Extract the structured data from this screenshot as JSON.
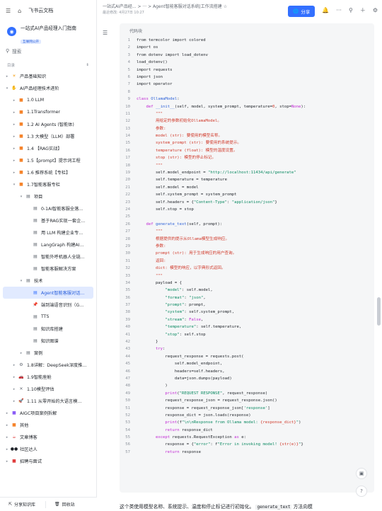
{
  "app": {
    "name": "飞书云文档"
  },
  "space": {
    "name": "一站式AI产品经理入门指南",
    "badge": "互联网公开"
  },
  "search": {
    "label": "搜索"
  },
  "toc": {
    "label": "目录"
  },
  "tree": [
    {
      "label": "产品基础知识",
      "depth": 0,
      "arrow": "▸",
      "icon": "☀",
      "color": "#f5a623",
      "active": false
    },
    {
      "label": "AI产品经理技术进阶",
      "depth": 0,
      "arrow": "▾",
      "icon": "✋",
      "color": "#f5a623",
      "active": false
    },
    {
      "label": "1.0 LLM",
      "depth": 1,
      "arrow": "▸",
      "icon": "■",
      "color": "#f5842c",
      "active": false
    },
    {
      "label": "1.1Transformer",
      "depth": 1,
      "arrow": "▸",
      "icon": "■",
      "color": "#f5842c",
      "active": false
    },
    {
      "label": "1.2 AI Agents (智能体)",
      "depth": 1,
      "arrow": "▸",
      "icon": "■",
      "color": "#f5842c",
      "active": false
    },
    {
      "label": "1.3 大模型（LLM）部署",
      "depth": 1,
      "arrow": "▸",
      "icon": "■",
      "color": "#f5842c",
      "active": false
    },
    {
      "label": "1.4 【RAG实战】",
      "depth": 1,
      "arrow": "▸",
      "icon": "■",
      "color": "#f5842c",
      "active": false
    },
    {
      "label": "1.5【prompt】提示词工程",
      "depth": 1,
      "arrow": "▸",
      "icon": "■",
      "color": "#f5842c",
      "active": false
    },
    {
      "label": "1.6 推荐系统【专栏】",
      "depth": 1,
      "arrow": "▸",
      "icon": "■",
      "color": "#f5842c",
      "active": false
    },
    {
      "label": "1.7智能客服专栏",
      "depth": 1,
      "arrow": "▾",
      "icon": "■",
      "color": "#f5842c",
      "active": false
    },
    {
      "label": "项目",
      "depth": 2,
      "arrow": "▾",
      "icon": "▤",
      "color": "#646a73",
      "active": false
    },
    {
      "label": "0-1AI智能客服全落...",
      "depth": 3,
      "arrow": "",
      "icon": "▤",
      "color": "#646a73",
      "active": false
    },
    {
      "label": "基于RAG实现一套企...",
      "depth": 3,
      "arrow": "",
      "icon": "▤",
      "color": "#646a73",
      "active": false
    },
    {
      "label": "用 LLM 构建企业专...",
      "depth": 3,
      "arrow": "",
      "icon": "▤",
      "color": "#646a73",
      "active": false
    },
    {
      "label": "LangGraph 构建AI...",
      "depth": 3,
      "arrow": "",
      "icon": "▤",
      "color": "#646a73",
      "active": false
    },
    {
      "label": "智能外呼机器人全链...",
      "depth": 3,
      "arrow": "",
      "icon": "▤",
      "color": "#646a73",
      "active": false
    },
    {
      "label": "智能客服解决方案",
      "depth": 3,
      "arrow": "",
      "icon": "▤",
      "color": "#646a73",
      "active": false
    },
    {
      "label": "技术",
      "depth": 2,
      "arrow": "▾",
      "icon": "▤",
      "color": "#646a73",
      "active": false
    },
    {
      "label": "Agent智能客服对话...",
      "depth": 3,
      "arrow": "",
      "icon": "▤",
      "color": "#3370ff",
      "active": true
    },
    {
      "label": "端到端语音识别（G...",
      "depth": 3,
      "arrow": "",
      "icon": "📌",
      "color": "#e03e3e",
      "active": false
    },
    {
      "label": "TTS",
      "depth": 3,
      "arrow": "",
      "icon": "▤",
      "color": "#646a73",
      "active": false
    },
    {
      "label": "知识库搭建",
      "depth": 3,
      "arrow": "",
      "icon": "▤",
      "color": "#646a73",
      "active": false
    },
    {
      "label": "知识图谱",
      "depth": 3,
      "arrow": "",
      "icon": "▤",
      "color": "#646a73",
      "active": false
    },
    {
      "label": "案例",
      "depth": 2,
      "arrow": "▸",
      "icon": "▤",
      "color": "#646a73",
      "active": false
    },
    {
      "label": "1.8详解：DeepSeek深度推...",
      "depth": 1,
      "arrow": "▸",
      "icon": "⚙",
      "color": "#646a73",
      "active": false
    },
    {
      "label": "1.9智能座舱",
      "depth": 1,
      "arrow": "▸",
      "icon": "🚗",
      "color": "#e03e3e",
      "active": false
    },
    {
      "label": "1.10模型评估",
      "depth": 1,
      "arrow": "▸",
      "icon": "✕",
      "color": "#646a73",
      "active": false
    },
    {
      "label": "1.11 从零开始的大语言模...",
      "depth": 1,
      "arrow": "▸",
      "icon": "🚀",
      "color": "#3370ff",
      "active": false
    },
    {
      "label": "AIGC项目案例拆解",
      "depth": 0,
      "arrow": "▸",
      "icon": "■",
      "color": "#8b5cf6",
      "active": false
    },
    {
      "label": "其他",
      "depth": 0,
      "arrow": "▸",
      "icon": "■",
      "color": "#f5842c",
      "active": false
    },
    {
      "label": "文章博客",
      "depth": 0,
      "arrow": "▸",
      "icon": "☕",
      "color": "#e03e3e",
      "active": false
    },
    {
      "label": "社区达人",
      "depth": 0,
      "arrow": "▸",
      "icon": "●●",
      "color": "#1f2329",
      "active": false
    },
    {
      "label": "招聘与面试",
      "depth": 0,
      "arrow": "▸",
      "icon": "■",
      "color": "#e03e3e",
      "active": false
    }
  ],
  "sidebar_bottom": {
    "share": "分享知识库",
    "trash": "回收站"
  },
  "header": {
    "breadcrumb": "一站式AI产品经... > ··· > Agent智能客服对话系统|工作流搭建 ☆",
    "updated": "最近修改: 4月27日 10:27",
    "share": "分享"
  },
  "code": {
    "label": "代码块",
    "lines": [
      [
        {
          "t": "from termcolor import colored",
          "c": ""
        }
      ],
      [
        {
          "t": "import os",
          "c": ""
        }
      ],
      [
        {
          "t": "from dotenv import load_dotenv",
          "c": ""
        }
      ],
      [
        {
          "t": "load_dotenv()",
          "c": ""
        }
      ],
      [
        {
          "t": "import requests",
          "c": ""
        }
      ],
      [
        {
          "t": "import json",
          "c": ""
        }
      ],
      [
        {
          "t": "import operator",
          "c": ""
        }
      ],
      [
        {
          "t": "",
          "c": ""
        }
      ],
      [
        {
          "t": "class ",
          "c": "kw"
        },
        {
          "t": "OllamaModel",
          "c": "fn"
        },
        {
          "t": ":",
          "c": ""
        }
      ],
      [
        {
          "t": "    def ",
          "c": "kw"
        },
        {
          "t": "__init__",
          "c": "fn"
        },
        {
          "t": "(self, model, system_prompt, temperature=",
          "c": ""
        },
        {
          "t": "0",
          "c": "num"
        },
        {
          "t": ", stop=",
          "c": ""
        },
        {
          "t": "None",
          "c": "kw"
        },
        {
          "t": "):",
          "c": ""
        }
      ],
      [
        {
          "t": "        \"\"\"",
          "c": "doc"
        }
      ],
      [
        {
          "t": "        用给定的参数初始化OllamaModel。",
          "c": "doc"
        }
      ],
      [
        {
          "t": "        参数:",
          "c": "doc"
        }
      ],
      [
        {
          "t": "        model (str): 要使用的模型名称。",
          "c": "doc"
        }
      ],
      [
        {
          "t": "        system_prompt (str): 要使用的系统提示。",
          "c": "doc"
        }
      ],
      [
        {
          "t": "        temperature (float): 模型的温度设置。",
          "c": "doc"
        }
      ],
      [
        {
          "t": "        stop (str): 模型的停止标记。",
          "c": "doc"
        }
      ],
      [
        {
          "t": "        \"\"\"",
          "c": "doc"
        }
      ],
      [
        {
          "t": "        self.model_endpoint = ",
          "c": ""
        },
        {
          "t": "\"http://localhost:11434/api/generate\"",
          "c": "str"
        }
      ],
      [
        {
          "t": "        self.temperature = temperature",
          "c": ""
        }
      ],
      [
        {
          "t": "        self.model = model",
          "c": ""
        }
      ],
      [
        {
          "t": "        self.system_prompt = system_prompt",
          "c": ""
        }
      ],
      [
        {
          "t": "        self.headers = {",
          "c": ""
        },
        {
          "t": "\"Content-Type\"",
          "c": "str"
        },
        {
          "t": ": ",
          "c": ""
        },
        {
          "t": "\"application/json\"",
          "c": "str"
        },
        {
          "t": "}",
          "c": ""
        }
      ],
      [
        {
          "t": "        self.stop = stop",
          "c": ""
        }
      ],
      [
        {
          "t": "",
          "c": ""
        }
      ],
      [
        {
          "t": "    def ",
          "c": "kw"
        },
        {
          "t": "generate_text",
          "c": "fn"
        },
        {
          "t": "(self, prompt):",
          "c": ""
        }
      ],
      [
        {
          "t": "        \"\"\"",
          "c": "doc"
        }
      ],
      [
        {
          "t": "        根据提供的提示从Ollama模型生成响应。",
          "c": "doc"
        }
      ],
      [
        {
          "t": "        参数:",
          "c": "doc"
        }
      ],
      [
        {
          "t": "        prompt (str): 用于生成响应的用户查询。",
          "c": "doc"
        }
      ],
      [
        {
          "t": "        返回:",
          "c": "doc"
        }
      ],
      [
        {
          "t": "        dict: 模型的响应，以字典形式返回。",
          "c": "doc"
        }
      ],
      [
        {
          "t": "        \"\"\"",
          "c": "doc"
        }
      ],
      [
        {
          "t": "        payload = {",
          "c": ""
        }
      ],
      [
        {
          "t": "            \"model\"",
          "c": "str"
        },
        {
          "t": ": self.model,",
          "c": ""
        }
      ],
      [
        {
          "t": "            \"format\"",
          "c": "str"
        },
        {
          "t": ": ",
          "c": ""
        },
        {
          "t": "\"json\"",
          "c": "str"
        },
        {
          "t": ",",
          "c": ""
        }
      ],
      [
        {
          "t": "            \"prompt\"",
          "c": "str"
        },
        {
          "t": ": prompt,",
          "c": ""
        }
      ],
      [
        {
          "t": "            \"system\"",
          "c": "str"
        },
        {
          "t": ": self.system_prompt,",
          "c": ""
        }
      ],
      [
        {
          "t": "            \"stream\"",
          "c": "str"
        },
        {
          "t": ": ",
          "c": ""
        },
        {
          "t": "False",
          "c": "kw"
        },
        {
          "t": ",",
          "c": ""
        }
      ],
      [
        {
          "t": "            \"temperature\"",
          "c": "str"
        },
        {
          "t": ": self.temperature,",
          "c": ""
        }
      ],
      [
        {
          "t": "            \"stop\"",
          "c": "str"
        },
        {
          "t": ": self.stop",
          "c": ""
        }
      ],
      [
        {
          "t": "        }",
          "c": ""
        }
      ],
      [
        {
          "t": "        try",
          "c": "kw"
        },
        {
          "t": ":",
          "c": ""
        }
      ],
      [
        {
          "t": "            request_response = requests.post(",
          "c": ""
        }
      ],
      [
        {
          "t": "                self.model_endpoint,",
          "c": ""
        }
      ],
      [
        {
          "t": "                headers=self.headers,",
          "c": ""
        }
      ],
      [
        {
          "t": "                data=json.dumps(payload)",
          "c": ""
        }
      ],
      [
        {
          "t": "            )",
          "c": ""
        }
      ],
      [
        {
          "t": "            print",
          "c": "kw"
        },
        {
          "t": "(",
          "c": ""
        },
        {
          "t": "\"REQUEST RESPONSE\"",
          "c": "str"
        },
        {
          "t": ", request_response)",
          "c": ""
        }
      ],
      [
        {
          "t": "            request_response_json = request_response.json()",
          "c": ""
        }
      ],
      [
        {
          "t": "            response = request_response_json[",
          "c": ""
        },
        {
          "t": "'response'",
          "c": "str"
        },
        {
          "t": "]",
          "c": ""
        }
      ],
      [
        {
          "t": "            response_dict = json.loads(response)",
          "c": ""
        }
      ],
      [
        {
          "t": "            print",
          "c": "kw"
        },
        {
          "t": "(f",
          "c": ""
        },
        {
          "t": "\"\\n\\nResponse from Ollama model: ",
          "c": "str"
        },
        {
          "t": "{response_dict}",
          "c": "doc"
        },
        {
          "t": "\"",
          "c": "str"
        },
        {
          "t": ")",
          "c": ""
        }
      ],
      [
        {
          "t": "            return ",
          "c": "kw"
        },
        {
          "t": "response_dict",
          "c": ""
        }
      ],
      [
        {
          "t": "        except ",
          "c": "kw"
        },
        {
          "t": "requests.RequestException ",
          "c": ""
        },
        {
          "t": "as ",
          "c": "kw"
        },
        {
          "t": "e:",
          "c": ""
        }
      ],
      [
        {
          "t": "            response = {",
          "c": ""
        },
        {
          "t": "\"error\"",
          "c": "str"
        },
        {
          "t": ": f",
          "c": ""
        },
        {
          "t": "\"Error in invoking model! ",
          "c": "str"
        },
        {
          "t": "{str(e)}",
          "c": "doc"
        },
        {
          "t": "\"",
          "c": "str"
        },
        {
          "t": "}",
          "c": ""
        }
      ],
      [
        {
          "t": "            return ",
          "c": "kw"
        },
        {
          "t": "response",
          "c": ""
        }
      ]
    ]
  },
  "body_text": {
    "before": "这个类使用模型名称、系统提示、温度和停止标记进行初始化。",
    "code": "generate_text",
    "after": " 方法向模"
  }
}
